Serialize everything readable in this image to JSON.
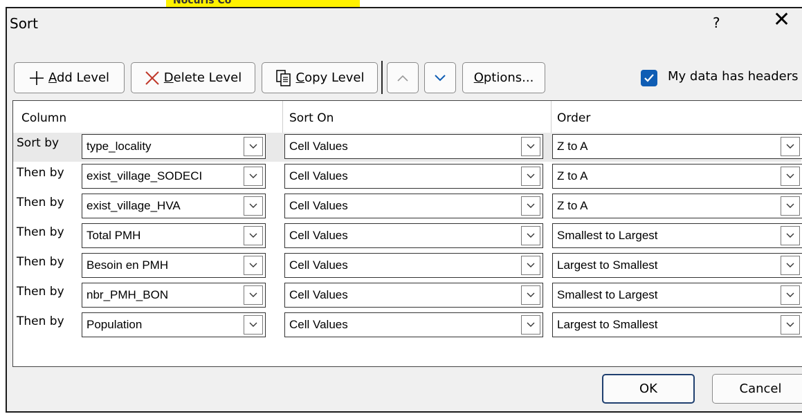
{
  "background": {
    "text": "Nocuris Co"
  },
  "dialog": {
    "title": "Sort",
    "help_label": "?",
    "close_label": "✕"
  },
  "toolbar": {
    "add_level_accel": "A",
    "add_level_rest": "dd Level",
    "delete_level_accel": "D",
    "delete_level_rest": "elete Level",
    "copy_level_accel": "C",
    "copy_level_rest": "opy Level",
    "options_accel": "O",
    "options_rest": "ptions...",
    "headers_checked": true,
    "headers_label_pre": "My data has ",
    "headers_label_accel": "h",
    "headers_label_post": "eaders"
  },
  "grid": {
    "headers": {
      "column": "Column",
      "sort_on": "Sort On",
      "order": "Order"
    },
    "rows": [
      {
        "label": "Sort by",
        "column": "type_locality",
        "sort_on": "Cell Values",
        "order": "Z to A"
      },
      {
        "label": "Then by",
        "column": "exist_village_SODECI",
        "sort_on": "Cell Values",
        "order": "Z to A"
      },
      {
        "label": "Then by",
        "column": "exist_village_HVA",
        "sort_on": "Cell Values",
        "order": "Z to A"
      },
      {
        "label": "Then by",
        "column": "Total PMH",
        "sort_on": "Cell Values",
        "order": "Smallest to Largest"
      },
      {
        "label": "Then by",
        "column": "Besoin en PMH",
        "sort_on": "Cell Values",
        "order": "Largest to Smallest"
      },
      {
        "label": "Then by",
        "column": "nbr_PMH_BON",
        "sort_on": "Cell Values",
        "order": "Smallest to Largest"
      },
      {
        "label": "Then by",
        "column": "Population",
        "sort_on": "Cell Values",
        "order": "Largest to Smallest"
      }
    ]
  },
  "footer": {
    "ok_label": "OK",
    "cancel_label": "Cancel"
  },
  "colors": {
    "accent": "#0f5db4",
    "delete_x": "#c0392b",
    "dialog_bg": "#f0f0f0"
  }
}
